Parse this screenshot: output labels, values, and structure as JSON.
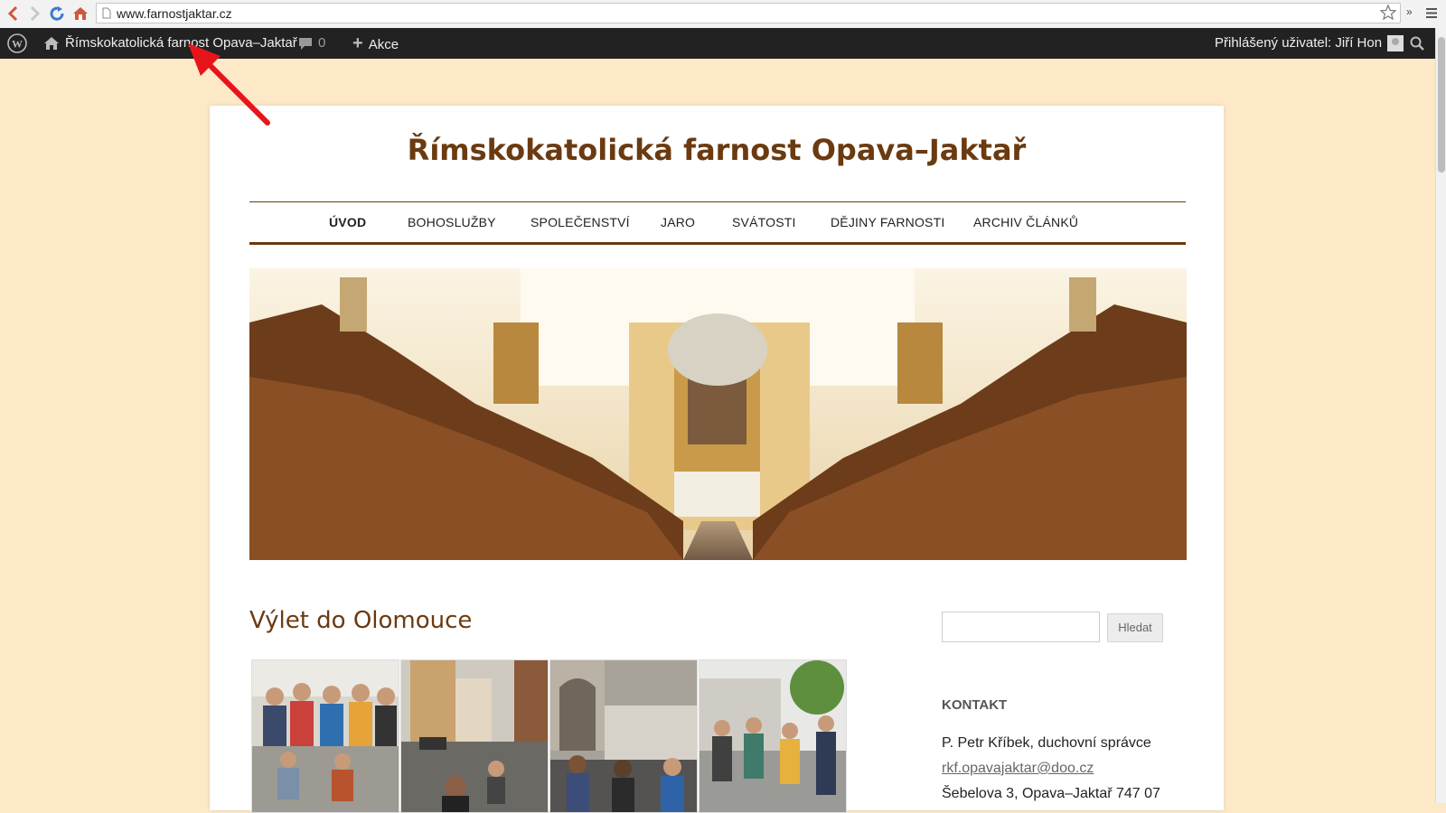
{
  "browser": {
    "url": "www.farnostjaktar.cz",
    "extensions_more": "»"
  },
  "admin_bar": {
    "site_name": "Římskokatolická farnost Opava–Jaktař",
    "comments_count": "0",
    "new_label": "Akce",
    "user_greeting": "Přihlášený uživatel: Jiří Hon"
  },
  "site": {
    "title": "Římskokatolická farnost Opava–Jaktař"
  },
  "nav": {
    "items": [
      {
        "label": "ÚVOD"
      },
      {
        "label": "BOHOSLUŽBY"
      },
      {
        "label": "SPOLEČENSTVÍ"
      },
      {
        "label": "JARO"
      },
      {
        "label": "SVÁTOSTI"
      },
      {
        "label": "DĚJINY FARNOSTI"
      },
      {
        "label": "ARCHIV ČLÁNKŮ"
      }
    ]
  },
  "post": {
    "title": "Výlet do Olomouce"
  },
  "sidebar": {
    "search_button": "Hledat",
    "contact": {
      "heading": "KONTAKT",
      "line1": "P. Petr Kříbek, duchovní správce",
      "email": "rkf.opavajaktar@doo.cz",
      "address": "Šebelova 3, Opava–Jaktař 747 07"
    }
  },
  "colors": {
    "page_background": "#fde9c7",
    "brand_brown": "#6b3a10",
    "admin_bar": "#222222",
    "annotation_arrow": "#e8141b"
  }
}
